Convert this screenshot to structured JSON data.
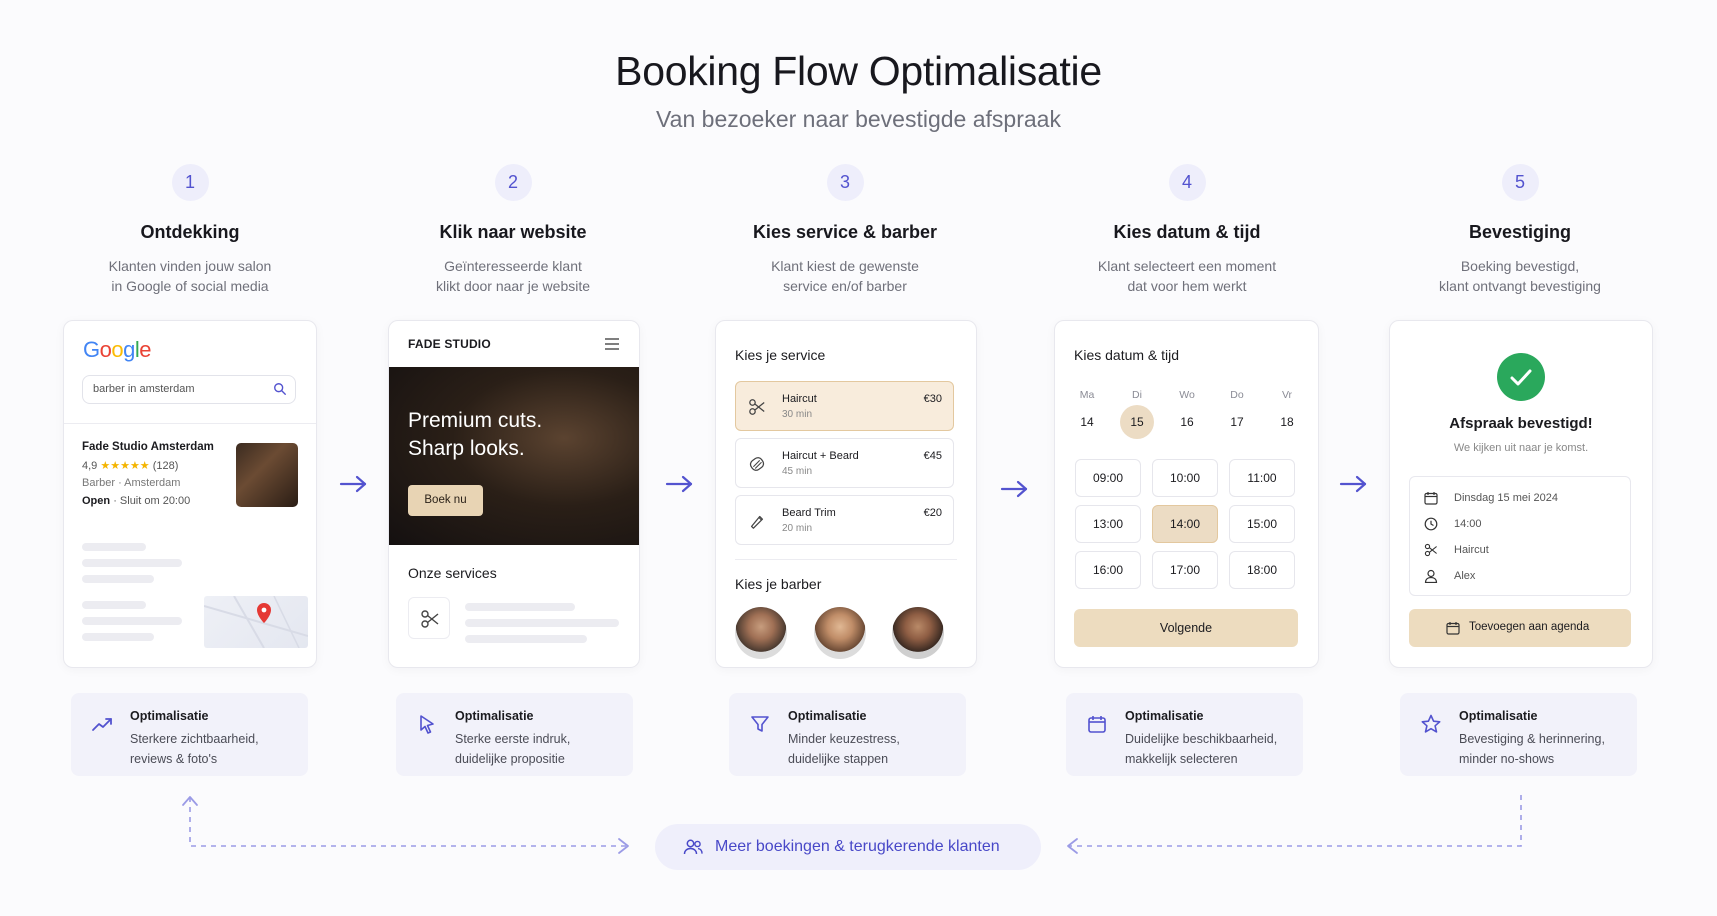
{
  "header": {
    "title": "Booking Flow Optimalisatie",
    "subtitle": "Van bezoeker naar bevestigde afspraak"
  },
  "steps": [
    {
      "num": "1",
      "title": "Ontdekking",
      "desc1": "Klanten vinden jouw salon",
      "desc2": "in Google of social media"
    },
    {
      "num": "2",
      "title": "Klik naar website",
      "desc1": "Geïnteresseerde klant",
      "desc2": "klikt door naar je website"
    },
    {
      "num": "3",
      "title": "Kies service & barber",
      "desc1": "Klant kiest de gewenste",
      "desc2": "service en/of barber"
    },
    {
      "num": "4",
      "title": "Kies datum & tijd",
      "desc1": "Klant selecteert een moment",
      "desc2": "dat voor hem werkt"
    },
    {
      "num": "5",
      "title": "Bevestiging",
      "desc1": "Boeking bevestigd,",
      "desc2": "klant ontvangt bevestiging"
    }
  ],
  "google": {
    "logo": "Google",
    "search_value": "barber in amsterdam",
    "business_name": "Fade Studio Amsterdam",
    "rating": "4,9",
    "stars": "★★★★★",
    "reviews": "(128)",
    "type": "Barber · Amsterdam",
    "open_label": "Open",
    "hours": "· Sluit om 20:00",
    "icon": "search-icon"
  },
  "website": {
    "brand": "FADE STUDIO",
    "hero_line1": "Premium cuts.",
    "hero_line2": "Sharp looks.",
    "cta": "Boek nu",
    "services_title": "Onze services"
  },
  "service_picker": {
    "service_title": "Kies je service",
    "services": [
      {
        "name": "Haircut",
        "duration": "30 min",
        "price": "€30",
        "icon": "scissors-icon"
      },
      {
        "name": "Haircut + Beard",
        "duration": "45 min",
        "price": "€45",
        "icon": "beard-icon"
      },
      {
        "name": "Beard Trim",
        "duration": "20 min",
        "price": "€20",
        "icon": "razor-icon"
      }
    ],
    "selected_service": 0,
    "barber_title": "Kies je barber"
  },
  "date_picker": {
    "title": "Kies datum & tijd",
    "days": [
      {
        "name": "Ma",
        "num": "14"
      },
      {
        "name": "Di",
        "num": "15"
      },
      {
        "name": "Wo",
        "num": "16"
      },
      {
        "name": "Do",
        "num": "17"
      },
      {
        "name": "Vr",
        "num": "18"
      }
    ],
    "selected_day": 1,
    "slots": [
      "09:00",
      "10:00",
      "11:00",
      "13:00",
      "14:00",
      "15:00",
      "16:00",
      "17:00",
      "18:00"
    ],
    "selected_slot": 4,
    "next_label": "Volgende"
  },
  "confirmation": {
    "title": "Afspraak bevestigd!",
    "subtitle": "We kijken uit naar je komst.",
    "date": "Dinsdag 15 mei 2024",
    "time": "14:00",
    "service": "Haircut",
    "barber": "Alex",
    "calendar_label": "Toevoegen aan agenda"
  },
  "optimisations": [
    {
      "title": "Optimalisatie",
      "line1": "Sterkere zichtbaarheid,",
      "line2": "reviews & foto's",
      "icon": "trending-up-icon"
    },
    {
      "title": "Optimalisatie",
      "line1": "Sterke eerste indruk,",
      "line2": "duidelijke propositie",
      "icon": "cursor-icon"
    },
    {
      "title": "Optimalisatie",
      "line1": "Minder keuzestress,",
      "line2": "duidelijke stappen",
      "icon": "filter-icon"
    },
    {
      "title": "Optimalisatie",
      "line1": "Duidelijke beschikbaarheid,",
      "line2": "makkelijk selecteren",
      "icon": "calendar-icon"
    },
    {
      "title": "Optimalisatie",
      "line1": "Bevestiging & herinnering,",
      "line2": "minder no-shows",
      "icon": "star-icon"
    }
  ],
  "footer": {
    "loop_label": "Meer boekingen & terugkerende klanten",
    "icon": "users-icon"
  },
  "colors": {
    "accent": "#5353cf",
    "sand": "#eddcbf",
    "success": "#2aa85c"
  }
}
